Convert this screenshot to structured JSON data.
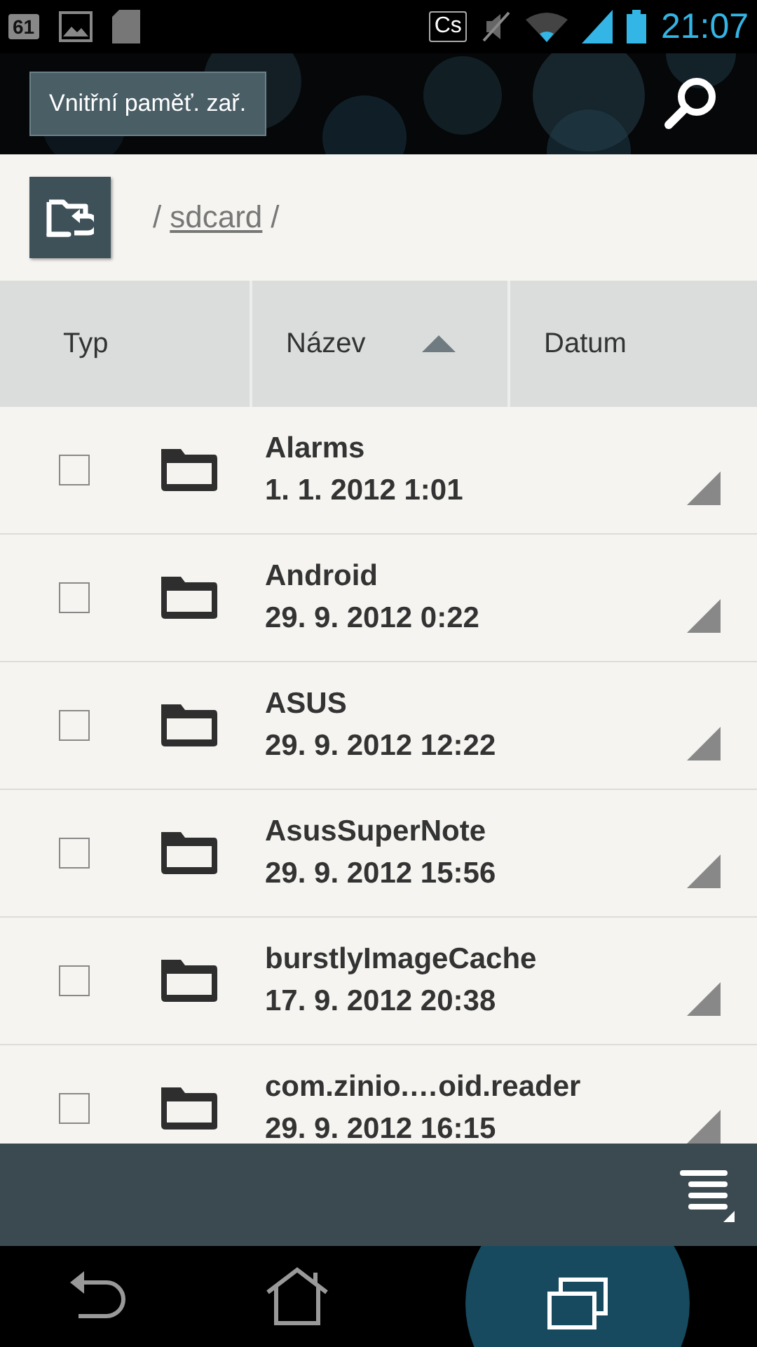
{
  "status_bar": {
    "battery_level_text": "61",
    "keyboard_badge": "Cs",
    "time": "21:07"
  },
  "header": {
    "storage_button": "Vnitřní paměť. zař."
  },
  "path": {
    "separator_before": "/",
    "folder": "sdcard",
    "separator_after": "/"
  },
  "columns": [
    {
      "label": "Typ",
      "sorted": false
    },
    {
      "label": "Název",
      "sorted": true
    },
    {
      "label": "Datum",
      "sorted": false
    }
  ],
  "files": [
    {
      "name": "Alarms",
      "date": "1. 1. 2012 1:01",
      "checked": false
    },
    {
      "name": "Android",
      "date": "29. 9. 2012 0:22",
      "checked": false
    },
    {
      "name": "ASUS",
      "date": "29. 9. 2012 12:22",
      "checked": false
    },
    {
      "name": "AsusSuperNote",
      "date": "29. 9. 2012 15:56",
      "checked": false
    },
    {
      "name": "burstlyImageCache",
      "date": "17. 9. 2012 20:38",
      "checked": false
    },
    {
      "name": "com.zinio.…oid.reader",
      "date": "29. 9. 2012 16:15",
      "checked": false
    }
  ]
}
